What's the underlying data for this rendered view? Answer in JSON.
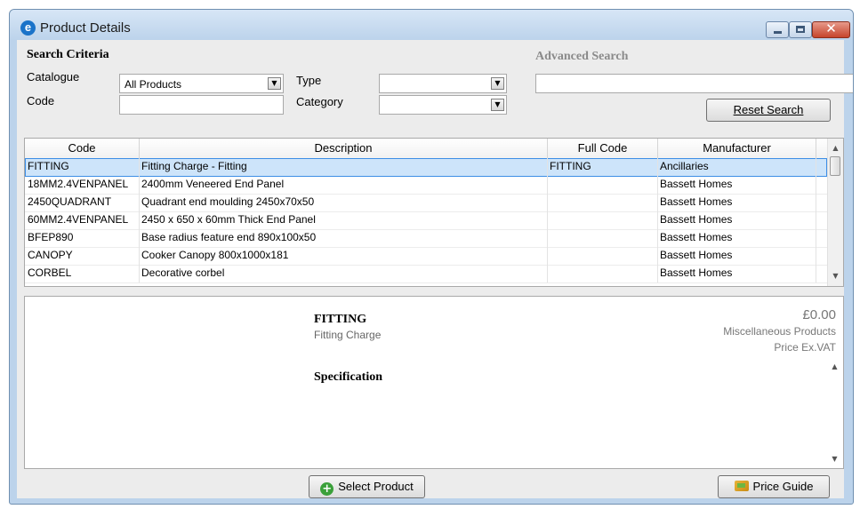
{
  "window": {
    "title": "Product Details",
    "logo_letter": "e"
  },
  "search": {
    "section_title": "Search Criteria",
    "catalogue_label": "Catalogue",
    "catalogue_value": "All Products",
    "type_label": "Type",
    "type_value": "",
    "code_label": "Code",
    "code_value": "",
    "category_label": "Category",
    "category_value": "",
    "advanced_title": "Advanced Search",
    "advanced_value": "",
    "reset_label": "Reset Search"
  },
  "table": {
    "columns": [
      "Code",
      "Description",
      "Full Code",
      "Manufacturer"
    ],
    "rows": [
      {
        "code": "FITTING",
        "description": "Fitting Charge - Fitting",
        "full_code": "FITTING",
        "manufacturer": "Ancillaries",
        "selected": true
      },
      {
        "code": "18MM2.4VENPANEL",
        "description": "2400mm Veneered End Panel",
        "full_code": "",
        "manufacturer": "Bassett Homes"
      },
      {
        "code": "2450QUADRANT",
        "description": "Quadrant end moulding 2450x70x50",
        "full_code": "",
        "manufacturer": "Bassett Homes"
      },
      {
        "code": "60MM2.4VENPANEL",
        "description": "2450 x 650 x 60mm Thick End Panel",
        "full_code": "",
        "manufacturer": "Bassett Homes"
      },
      {
        "code": "BFEP890",
        "description": "Base radius feature end 890x100x50",
        "full_code": "",
        "manufacturer": "Bassett Homes"
      },
      {
        "code": "CANOPY",
        "description": "Cooker Canopy 800x1000x181",
        "full_code": "",
        "manufacturer": "Bassett Homes"
      },
      {
        "code": "CORBEL",
        "description": "Decorative corbel",
        "full_code": "",
        "manufacturer": "Bassett Homes"
      }
    ]
  },
  "details": {
    "title": "FITTING",
    "subtitle": "Fitting Charge",
    "price": "£0.00",
    "category": "Miscellaneous Products",
    "price_note": "Price Ex.VAT",
    "spec_heading": "Specification"
  },
  "footer": {
    "select_label": "Select Product",
    "guide_label": "Price Guide"
  },
  "icons": {
    "select": "plus-circle-icon",
    "guide": "price-guide-icon"
  }
}
